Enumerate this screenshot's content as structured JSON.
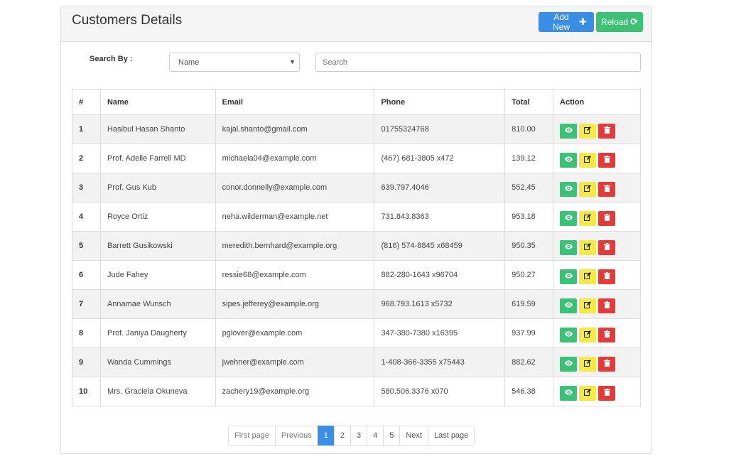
{
  "header": {
    "title": "Customers Details",
    "add_label": "Add New",
    "reload_label": "Reload"
  },
  "search": {
    "label": "Search By :",
    "select_value": "Name",
    "placeholder": "Search"
  },
  "table": {
    "columns": [
      "#",
      "Name",
      "Email",
      "Phone",
      "Total",
      "Action"
    ],
    "rows": [
      {
        "id": "1",
        "name": "Hasibul Hasan Shanto",
        "email": "kajal.shanto@gmail.com",
        "phone": "01755324768",
        "total": "810.00"
      },
      {
        "id": "2",
        "name": "Prof. Adelle Farrell MD",
        "email": "michaela04@example.com",
        "phone": "(467) 681-3805 x472",
        "total": "139.12"
      },
      {
        "id": "3",
        "name": "Prof. Gus Kub",
        "email": "conor.donnelly@example.com",
        "phone": "639.797.4046",
        "total": "552.45"
      },
      {
        "id": "4",
        "name": "Royce Ortiz",
        "email": "neha.wilderman@example.net",
        "phone": "731.843.8363",
        "total": "953.18"
      },
      {
        "id": "5",
        "name": "Barrett Gusikowski",
        "email": "meredith.bernhard@example.org",
        "phone": "(816) 574-8845 x68459",
        "total": "950.35"
      },
      {
        "id": "6",
        "name": "Jude Fahey",
        "email": "ressie68@example.com",
        "phone": "882-280-1643 x96704",
        "total": "950.27"
      },
      {
        "id": "7",
        "name": "Annamae Wunsch",
        "email": "sipes.jefferey@example.org",
        "phone": "968.793.1613 x5732",
        "total": "619.59"
      },
      {
        "id": "8",
        "name": "Prof. Janiya Daugherty",
        "email": "pglover@example.com",
        "phone": "347-380-7380 x16395",
        "total": "937.99"
      },
      {
        "id": "9",
        "name": "Wanda Cummings",
        "email": "jwehner@example.com",
        "phone": "1-408-366-3355 x75443",
        "total": "882.62"
      },
      {
        "id": "10",
        "name": "Mrs. Graciela Okuneva",
        "email": "zachery19@example.org",
        "phone": "580.506.3376 x070",
        "total": "546.38"
      }
    ]
  },
  "pagination": {
    "first": "First page",
    "previous": "Previous",
    "pages": [
      "1",
      "2",
      "3",
      "4",
      "5"
    ],
    "active_page": "1",
    "next": "Next",
    "last": "Last page"
  },
  "icons": {
    "add": "plus-icon",
    "reload": "refresh-icon",
    "view": "eye-icon",
    "edit": "edit-icon",
    "delete": "trash-icon"
  },
  "colors": {
    "primary": "#3a8ee6",
    "success": "#3cc276",
    "warning": "#f5e94a",
    "danger": "#e23b3b"
  }
}
